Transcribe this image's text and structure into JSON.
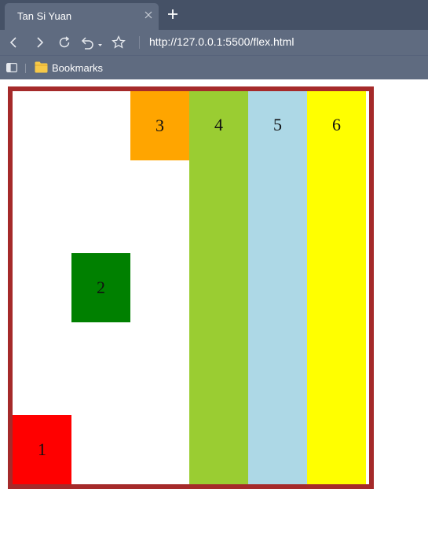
{
  "browser": {
    "tab_title": "Tan Si Yuan",
    "address": "http://127.0.0.1:5500/flex.html",
    "bookmarks_label": "Bookmarks"
  },
  "page": {
    "container_border_color": "#a52a2a",
    "items": [
      {
        "label": "1",
        "color": "#ff0000"
      },
      {
        "label": "2",
        "color": "#008000"
      },
      {
        "label": "3",
        "color": "#ffa500"
      },
      {
        "label": "4",
        "color": "#9acd32"
      },
      {
        "label": "5",
        "color": "#add8e6"
      },
      {
        "label": "6",
        "color": "#ffff00"
      }
    ]
  }
}
